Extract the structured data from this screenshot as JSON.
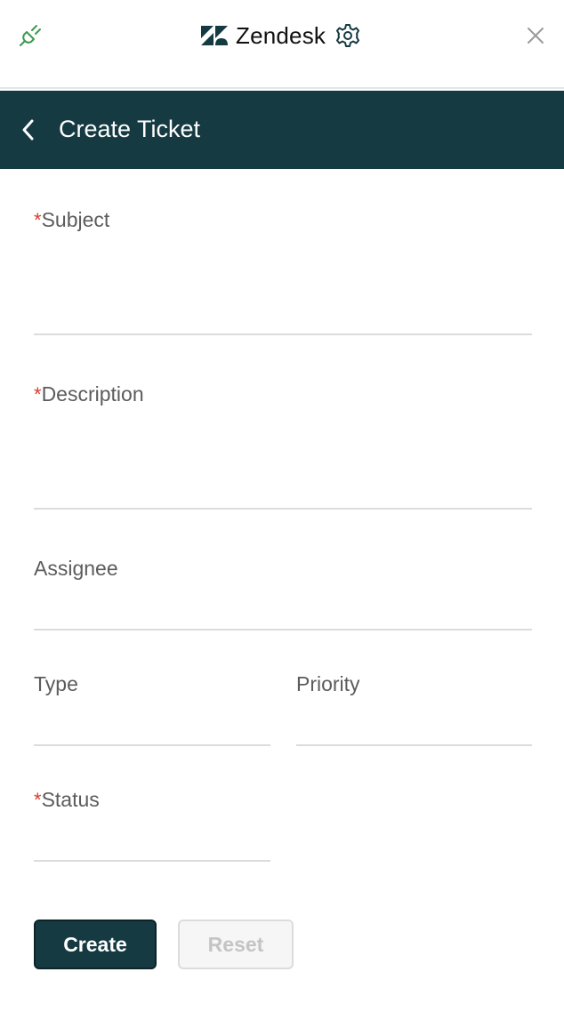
{
  "app": {
    "brand_name": "Zendesk",
    "icons": [
      "plug-icon",
      "zendesk-logo-icon",
      "gear-icon",
      "close-icon",
      "chevron-left-icon"
    ]
  },
  "header": {
    "title": "Create Ticket"
  },
  "form": {
    "required_marker": "*",
    "subject": {
      "label": "Subject",
      "value": "",
      "required": true
    },
    "description": {
      "label": "Description",
      "value": "",
      "required": true
    },
    "assignee": {
      "label": "Assignee",
      "value": ""
    },
    "type": {
      "label": "Type",
      "value": ""
    },
    "priority": {
      "label": "Priority",
      "value": ""
    },
    "status": {
      "label": "Status",
      "value": "",
      "required": true
    }
  },
  "actions": {
    "create_label": "Create",
    "reset_label": "Reset"
  },
  "colors": {
    "header_bg": "#153a42",
    "required": "#d93b2b",
    "plug_accent": "#3a9b4f",
    "disabled_text": "#c4c4c4"
  }
}
